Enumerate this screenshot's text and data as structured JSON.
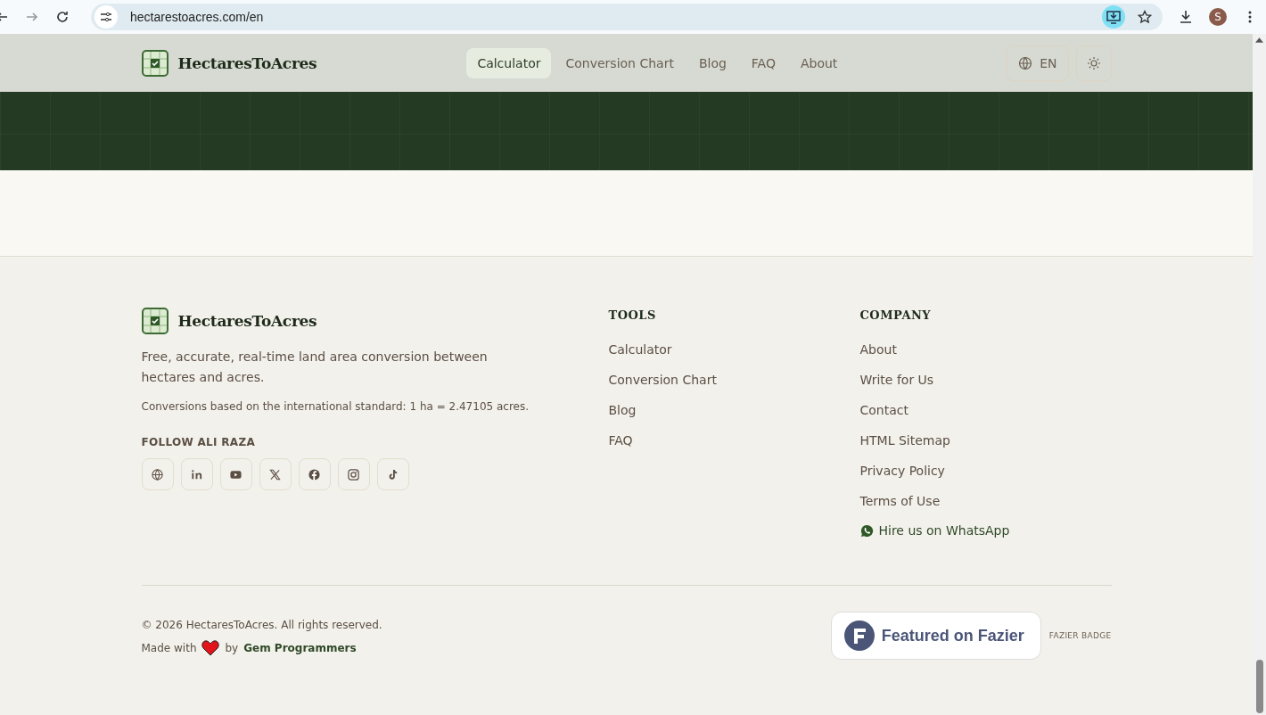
{
  "browser": {
    "url": "hectarestoacres.com/en",
    "profile_initial": "S"
  },
  "header": {
    "brand": "HectaresToAcres",
    "nav": [
      {
        "label": "Calculator",
        "selected": true
      },
      {
        "label": "Conversion Chart",
        "selected": false
      },
      {
        "label": "Blog",
        "selected": false
      },
      {
        "label": "FAQ",
        "selected": false
      },
      {
        "label": "About",
        "selected": false
      }
    ],
    "language": "EN"
  },
  "footer": {
    "brand": "HectaresToAcres",
    "description": "Free, accurate, real-time land area conversion between hectares and acres.",
    "note": "Conversions based on the international standard: 1 ha = 2.47105 acres.",
    "follow_heading": "FOLLOW ALI RAZA",
    "columns": [
      {
        "heading": "TOOLS",
        "links": [
          "Calculator",
          "Conversion Chart",
          "Blog",
          "FAQ"
        ]
      },
      {
        "heading": "COMPANY",
        "links": [
          "About",
          "Write for Us",
          "Contact",
          "HTML Sitemap",
          "Privacy Policy",
          "Terms of Use"
        ],
        "whatsapp": "Hire us on WhatsApp"
      }
    ],
    "copyright": "© 2026 HectaresToAcres. All rights reserved.",
    "made_with": "Made with",
    "by": "by",
    "author": "Gem Programmers",
    "badge": "Featured on Fazier",
    "badge_caption": "FAZIER BADGE"
  }
}
